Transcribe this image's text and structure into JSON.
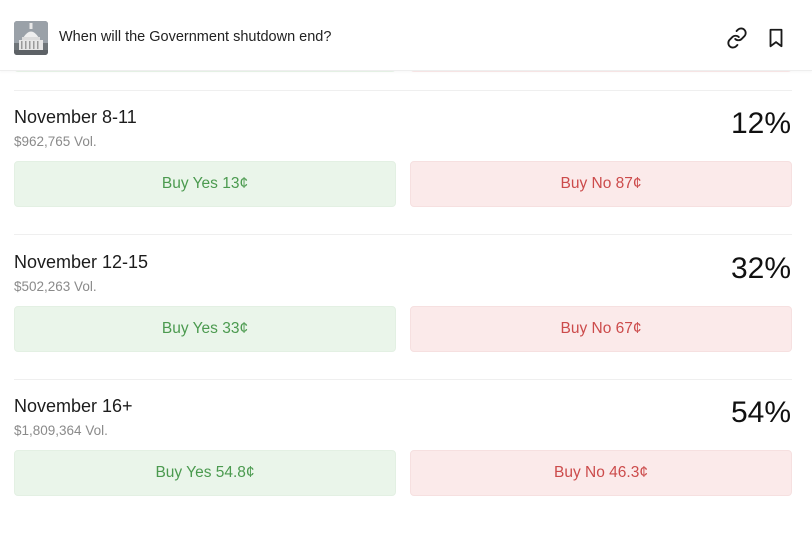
{
  "header": {
    "title": "When will the Government shutdown end?",
    "avatar_icon": "capitol-building-icon",
    "actions": [
      {
        "icon": "link-icon"
      },
      {
        "icon": "bookmark-icon"
      }
    ]
  },
  "outcomes": [
    {
      "name": "November 8-11",
      "volume": "$962,765 Vol.",
      "probability": "12%",
      "buy_yes": "Buy Yes 13¢",
      "buy_no": "Buy No 87¢"
    },
    {
      "name": "November 12-15",
      "volume": "$502,263 Vol.",
      "probability": "32%",
      "buy_yes": "Buy Yes 33¢",
      "buy_no": "Buy No 67¢"
    },
    {
      "name": "November 16+",
      "volume": "$1,809,364 Vol.",
      "probability": "54%",
      "buy_yes": "Buy Yes 54.8¢",
      "buy_no": "Buy No 46.3¢"
    }
  ],
  "colors": {
    "yes_bg": "#eaf5ea",
    "yes_text": "#4b9a4f",
    "no_bg": "#fbeaea",
    "no_text": "#cc4b4b"
  }
}
